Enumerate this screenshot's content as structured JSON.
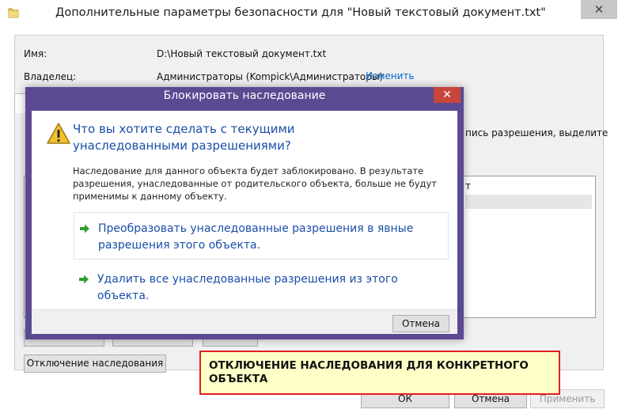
{
  "window": {
    "title": "Дополнительные параметры безопасности  для \"Новый текстовый документ.txt\"",
    "close_glyph": "✕"
  },
  "properties": {
    "name_label": "Имя:",
    "name_value": "D:\\Новый текстовый документ.txt",
    "owner_label": "Владелец:",
    "owner_value": "Администраторы (Kompick\\Администраторы)",
    "change_link": "Изменить"
  },
  "background": {
    "partial_text": "пись разрешения, выделите",
    "partial_col": "т"
  },
  "buttons": {
    "disable_inheritance": "Отключение наследования",
    "ok": "ОК",
    "cancel": "Отмена",
    "apply": "Применить"
  },
  "annotation": {
    "text": "ОТКЛЮЧЕНИЕ НАСЛЕДОВАНИЯ ДЛЯ КОНКРЕТНОГО ОБЪЕКТА"
  },
  "dialog": {
    "title": "Блокировать наследование",
    "close_glyph": "✕",
    "heading": "Что вы хотите сделать с текущими унаследованными разрешениями?",
    "message": "Наследование для данного объекта будет заблокировано. В результате разрешения, унаследованные от родительского объекта, больше не будут применимы к данному объекту.",
    "option_convert": "Преобразовать унаследованные разрешения в явные разрешения этого объекта.",
    "option_remove": "Удалить все унаследованные разрешения из этого объекта.",
    "cancel_label": "Отмена"
  },
  "icons": {
    "warning": "warning-icon",
    "arrow": "green-arrow-icon",
    "folder": "folder-icon"
  },
  "colors": {
    "dialog_frame": "#5b4a92",
    "close_button": "#c7463a",
    "link_blue": "#1a4ea8",
    "annotation_bg": "#ffffc8",
    "annotation_border": "#e02020"
  }
}
